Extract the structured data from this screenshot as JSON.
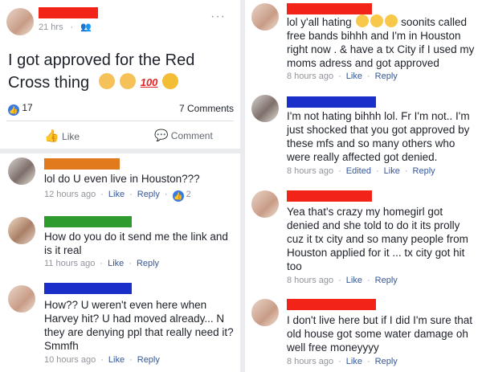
{
  "post": {
    "timestamp": "21 hrs",
    "privacy_icon": "friends-icon",
    "body": "I got approved for the Red Cross thing",
    "reaction_count": "17",
    "comments_count": "7 Comments",
    "like_label": "Like",
    "comment_label": "Comment"
  },
  "left_comments": [
    {
      "text": "lol do U even live in Houston???",
      "time": "12 hours ago",
      "like": "Like",
      "reply": "Reply",
      "likes": "2"
    },
    {
      "text": "How do you do it send me the link and is it real",
      "time": "11 hours ago",
      "like": "Like",
      "reply": "Reply"
    },
    {
      "text": "How?? U weren't even here when Harvey hit? U had moved already... N they are denying ppl that really need it? Smmfh",
      "time": "10 hours ago",
      "like": "Like",
      "reply": "Reply"
    }
  ],
  "right_comments": [
    {
      "text_a": "lol y'all hating",
      "text_b": "soonits called free bands bihhh and I'm in Houston right now . & have a tx City if I used my moms adress and got approved",
      "time": "8 hours ago",
      "like": "Like",
      "reply": "Reply"
    },
    {
      "text": "I'm not hating bihhh lol. Fr I'm not.. I'm just shocked that you got approved by these mfs and so many others who were really affected got denied.",
      "time": "8 hours ago",
      "edited": "Edited",
      "like": "Like",
      "reply": "Reply"
    },
    {
      "text": "Yea that's crazy my homegirl got denied and she told to do it its prolly cuz it tx city and so many people from Houston applied for it ... tx city got hit too",
      "time": "8 hours ago",
      "like": "Like",
      "reply": "Reply"
    },
    {
      "text": "I don't live here but if I did I'm sure that old house got some water damage oh well free moneyyyy",
      "time": "8 hours ago",
      "like": "Like",
      "reply": "Reply"
    }
  ],
  "colors": {
    "link": "#365899",
    "meta": "#90949c",
    "redact_red": "#f22418",
    "redact_blue": "#1a2fc9",
    "redact_orange": "#e07a1c",
    "redact_green": "#2e9b2e",
    "like_blue": "#3b7ae0"
  }
}
